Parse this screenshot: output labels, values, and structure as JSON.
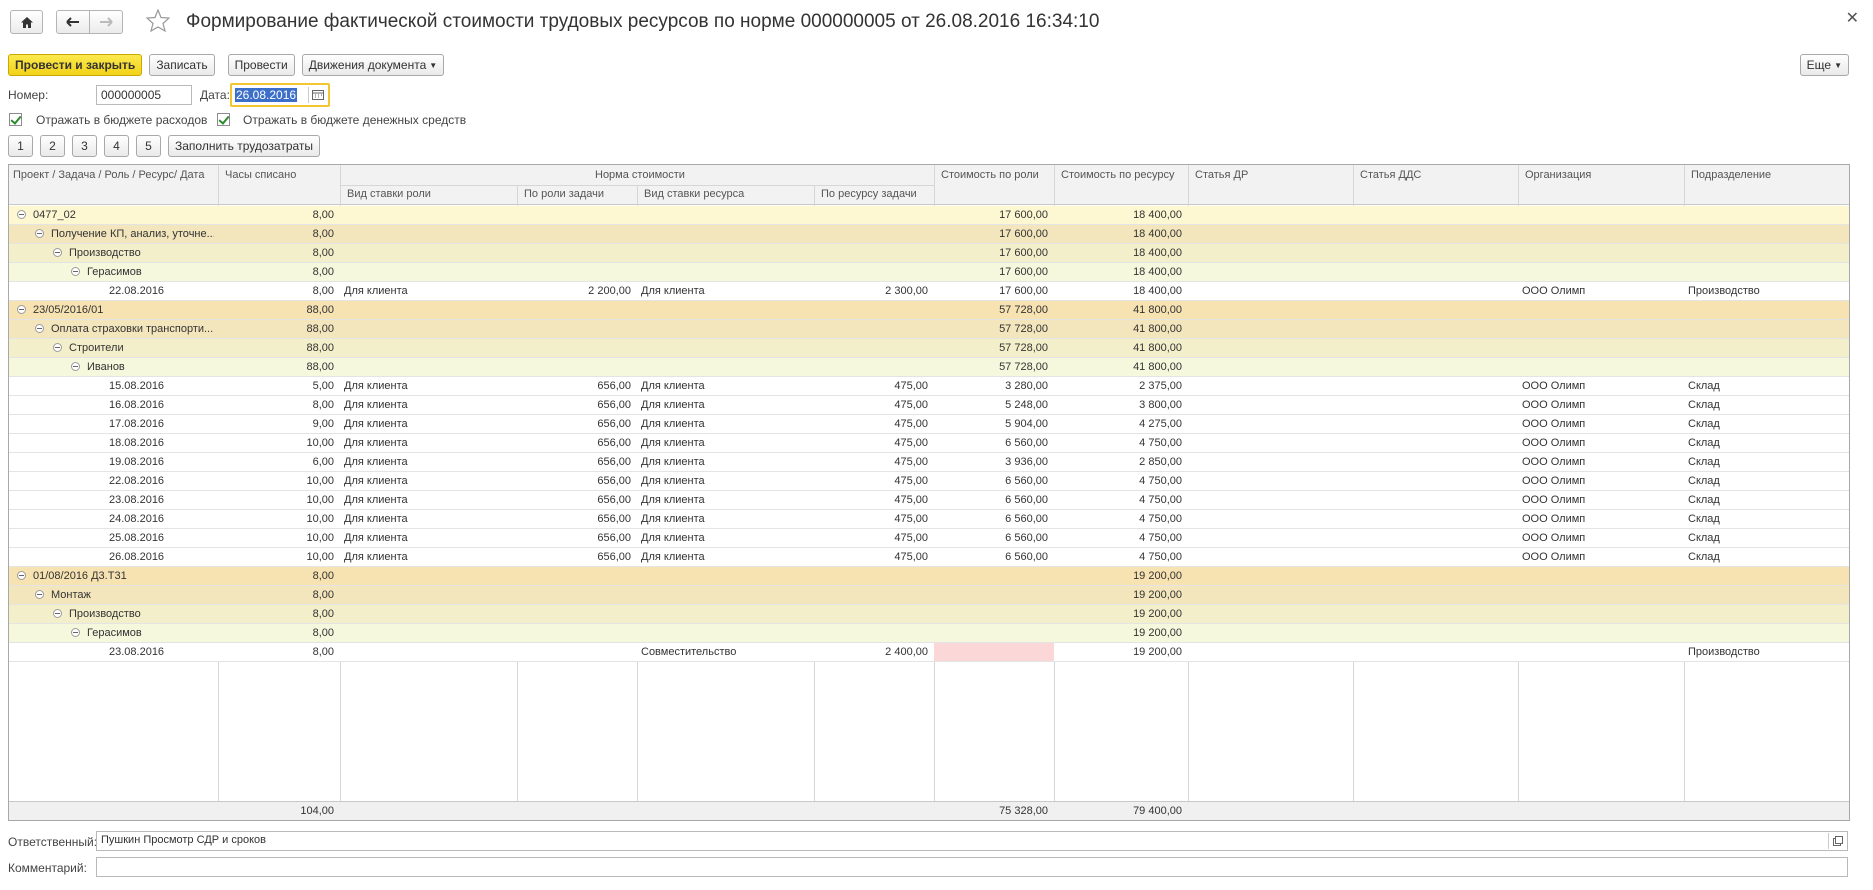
{
  "title": "Формирование фактической стоимости трудовых ресурсов по норме 000000005 от 26.08.2016 16:34:10",
  "toolbar": {
    "post_close": "Провести и закрыть",
    "save": "Записать",
    "post": "Провести",
    "movements": "Движения документа",
    "more": "Еще"
  },
  "form": {
    "number_label": "Номер:",
    "number": "000000005",
    "date_label": "Дата:",
    "date": "26.08.2016",
    "chk_expenses": "Отражать в бюджете расходов",
    "chk_cash": "Отражать в бюджете денежных средств",
    "page_buttons": [
      "1",
      "2",
      "3",
      "4",
      "5"
    ],
    "fill_button": "Заполнить трудозатраты"
  },
  "table": {
    "headers": {
      "project": "Проект / Задача / Роль / Ресурс/ Дата",
      "hours": "Часы списано",
      "norm": "Норма стоимости",
      "role_rate_type": "Вид ставки роли",
      "by_task_role": "По роли задачи",
      "res_rate_type": "Вид ставки ресурса",
      "by_task_res": "По ресурсу задачи",
      "cost_role": "Стоимость по роли",
      "cost_res": "Стоимость по ресурсу",
      "article_dr": "Статья ДР",
      "article_dds": "Статья ДДС",
      "org": "Организация",
      "dept": "Подразделение"
    },
    "rows": [
      {
        "lvl": 0,
        "first": true,
        "name": "0477_02",
        "hours": "8,00",
        "rrt": "",
        "btr": "",
        "srt": "",
        "bts": "",
        "cr": "17 600,00",
        "cs": "18 400,00",
        "org": "",
        "dept": ""
      },
      {
        "lvl": 1,
        "name": "Получение КП, анализ, уточне...",
        "hours": "8,00",
        "rrt": "",
        "btr": "",
        "srt": "",
        "bts": "",
        "cr": "17 600,00",
        "cs": "18 400,00",
        "org": "",
        "dept": ""
      },
      {
        "lvl": 2,
        "name": "Производство",
        "hours": "8,00",
        "rrt": "",
        "btr": "",
        "srt": "",
        "bts": "",
        "cr": "17 600,00",
        "cs": "18 400,00",
        "org": "",
        "dept": ""
      },
      {
        "lvl": 3,
        "name": "Герасимов",
        "hours": "8,00",
        "rrt": "",
        "btr": "",
        "srt": "",
        "bts": "",
        "cr": "17 600,00",
        "cs": "18 400,00",
        "org": "",
        "dept": ""
      },
      {
        "lvl": 4,
        "name": "22.08.2016",
        "hours": "8,00",
        "rrt": "Для клиента",
        "btr": "2 200,00",
        "srt": "Для клиента",
        "bts": "2 300,00",
        "cr": "17 600,00",
        "cs": "18 400,00",
        "org": "ООО Олимп",
        "dept": "Производство"
      },
      {
        "lvl": 0,
        "name": "23/05/2016/01",
        "hours": "88,00",
        "rrt": "",
        "btr": "",
        "srt": "",
        "bts": "",
        "cr": "57 728,00",
        "cs": "41 800,00",
        "org": "",
        "dept": ""
      },
      {
        "lvl": 1,
        "name": "Оплата страховки транспорти...",
        "hours": "88,00",
        "rrt": "",
        "btr": "",
        "srt": "",
        "bts": "",
        "cr": "57 728,00",
        "cs": "41 800,00",
        "org": "",
        "dept": ""
      },
      {
        "lvl": 2,
        "name": "Строители",
        "hours": "88,00",
        "rrt": "",
        "btr": "",
        "srt": "",
        "bts": "",
        "cr": "57 728,00",
        "cs": "41 800,00",
        "org": "",
        "dept": ""
      },
      {
        "lvl": 3,
        "name": "Иванов",
        "hours": "88,00",
        "rrt": "",
        "btr": "",
        "srt": "",
        "bts": "",
        "cr": "57 728,00",
        "cs": "41 800,00",
        "org": "",
        "dept": ""
      },
      {
        "lvl": 4,
        "name": "15.08.2016",
        "hours": "5,00",
        "rrt": "Для клиента",
        "btr": "656,00",
        "srt": "Для клиента",
        "bts": "475,00",
        "cr": "3 280,00",
        "cs": "2 375,00",
        "org": "ООО Олимп",
        "dept": "Склад"
      },
      {
        "lvl": 4,
        "name": "16.08.2016",
        "hours": "8,00",
        "rrt": "Для клиента",
        "btr": "656,00",
        "srt": "Для клиента",
        "bts": "475,00",
        "cr": "5 248,00",
        "cs": "3 800,00",
        "org": "ООО Олимп",
        "dept": "Склад"
      },
      {
        "lvl": 4,
        "name": "17.08.2016",
        "hours": "9,00",
        "rrt": "Для клиента",
        "btr": "656,00",
        "srt": "Для клиента",
        "bts": "475,00",
        "cr": "5 904,00",
        "cs": "4 275,00",
        "org": "ООО Олимп",
        "dept": "Склад"
      },
      {
        "lvl": 4,
        "name": "18.08.2016",
        "hours": "10,00",
        "rrt": "Для клиента",
        "btr": "656,00",
        "srt": "Для клиента",
        "bts": "475,00",
        "cr": "6 560,00",
        "cs": "4 750,00",
        "org": "ООО Олимп",
        "dept": "Склад"
      },
      {
        "lvl": 4,
        "name": "19.08.2016",
        "hours": "6,00",
        "rrt": "Для клиента",
        "btr": "656,00",
        "srt": "Для клиента",
        "bts": "475,00",
        "cr": "3 936,00",
        "cs": "2 850,00",
        "org": "ООО Олимп",
        "dept": "Склад"
      },
      {
        "lvl": 4,
        "name": "22.08.2016",
        "hours": "10,00",
        "rrt": "Для клиента",
        "btr": "656,00",
        "srt": "Для клиента",
        "bts": "475,00",
        "cr": "6 560,00",
        "cs": "4 750,00",
        "org": "ООО Олимп",
        "dept": "Склад"
      },
      {
        "lvl": 4,
        "name": "23.08.2016",
        "hours": "10,00",
        "rrt": "Для клиента",
        "btr": "656,00",
        "srt": "Для клиента",
        "bts": "475,00",
        "cr": "6 560,00",
        "cs": "4 750,00",
        "org": "ООО Олимп",
        "dept": "Склад"
      },
      {
        "lvl": 4,
        "name": "24.08.2016",
        "hours": "10,00",
        "rrt": "Для клиента",
        "btr": "656,00",
        "srt": "Для клиента",
        "bts": "475,00",
        "cr": "6 560,00",
        "cs": "4 750,00",
        "org": "ООО Олимп",
        "dept": "Склад"
      },
      {
        "lvl": 4,
        "name": "25.08.2016",
        "hours": "10,00",
        "rrt": "Для клиента",
        "btr": "656,00",
        "srt": "Для клиента",
        "bts": "475,00",
        "cr": "6 560,00",
        "cs": "4 750,00",
        "org": "ООО Олимп",
        "dept": "Склад"
      },
      {
        "lvl": 4,
        "name": "26.08.2016",
        "hours": "10,00",
        "rrt": "Для клиента",
        "btr": "656,00",
        "srt": "Для клиента",
        "bts": "475,00",
        "cr": "6 560,00",
        "cs": "4 750,00",
        "org": "ООО Олимп",
        "dept": "Склад"
      },
      {
        "lvl": 0,
        "name": "01/08/2016 Д3.Т31",
        "hours": "8,00",
        "rrt": "",
        "btr": "",
        "srt": "",
        "bts": "",
        "cr": "",
        "cs": "19 200,00",
        "org": "",
        "dept": ""
      },
      {
        "lvl": 1,
        "name": "Монтаж",
        "hours": "8,00",
        "rrt": "",
        "btr": "",
        "srt": "",
        "bts": "",
        "cr": "",
        "cs": "19 200,00",
        "org": "",
        "dept": ""
      },
      {
        "lvl": 2,
        "name": "Производство",
        "hours": "8,00",
        "rrt": "",
        "btr": "",
        "srt": "",
        "bts": "",
        "cr": "",
        "cs": "19 200,00",
        "org": "",
        "dept": ""
      },
      {
        "lvl": 3,
        "name": "Герасимов",
        "hours": "8,00",
        "rrt": "",
        "btr": "",
        "srt": "",
        "bts": "",
        "cr": "",
        "cs": "19 200,00",
        "org": "",
        "dept": ""
      },
      {
        "lvl": 4,
        "pink": true,
        "name": "23.08.2016",
        "hours": "8,00",
        "rrt": "",
        "btr": "",
        "srt": "Совместительство",
        "bts": "2 400,00",
        "cr": "",
        "cs": "19 200,00",
        "org": "",
        "dept": "Производство"
      }
    ],
    "totals": {
      "hours": "104,00",
      "cost_role": "75 328,00",
      "cost_res": "79 400,00"
    }
  },
  "bottom": {
    "responsible_label": "Ответственный:",
    "responsible": "Пушкин Просмотр СДР и сроков",
    "comment_label": "Комментарий:",
    "comment": ""
  }
}
